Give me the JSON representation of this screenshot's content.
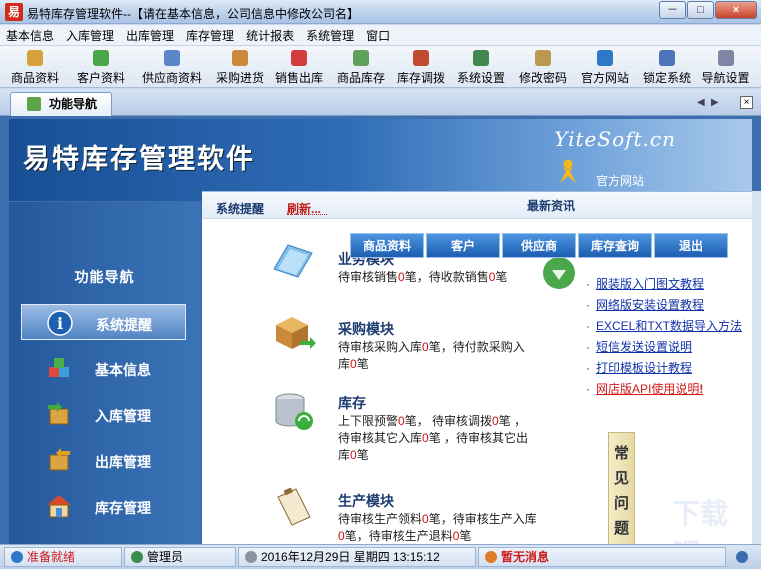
{
  "window": {
    "app_icon_char": "易",
    "title": "易特库存管理软件--【请在基本信息，公司信息中修改公司名】",
    "minimize": "－",
    "maximize": "□",
    "close": "×"
  },
  "menu": [
    "基本信息",
    "入库管理",
    "出库管理",
    "库存管理",
    "统计报表",
    "系统管理",
    "窗口"
  ],
  "toolbar": [
    {
      "label": "商品资料",
      "icon": "goods-icon",
      "color": "#d8a23a"
    },
    {
      "label": "客户资料",
      "icon": "customers-icon",
      "color": "#4aa84a"
    },
    {
      "label": "供应商资料",
      "icon": "supplier-icon",
      "color": "#5a86c8"
    },
    {
      "label": "采购进货",
      "icon": "purchase-icon",
      "color": "#c98a3c"
    },
    {
      "label": "销售出库",
      "icon": "sales-icon",
      "color": "#d23c3c"
    },
    {
      "label": "商品库存",
      "icon": "inventory-icon",
      "color": "#5fa05a"
    },
    {
      "label": "库存调拨",
      "icon": "transfer-icon",
      "color": "#c04a32"
    },
    {
      "label": "系统设置",
      "icon": "settings-icon",
      "color": "#3f8a4c"
    },
    {
      "label": "修改密码",
      "icon": "password-icon",
      "color": "#b99a50"
    },
    {
      "label": "官方网站",
      "icon": "website-icon",
      "color": "#2f78c8"
    },
    {
      "label": "锁定系统",
      "icon": "lock-icon",
      "color": "#4f74b8"
    },
    {
      "label": "导航设置",
      "icon": "nav-settings-icon",
      "color": "#7f86a4"
    }
  ],
  "tab": {
    "label": "功能导航",
    "prev": "◀",
    "next": "▶",
    "close": "×"
  },
  "banner": {
    "title": "易特库存管理软件",
    "logo": "YiteSoft.cn",
    "site_link": "官方网站"
  },
  "leftnav": {
    "heading": "功能导航",
    "items": [
      {
        "label": "系统提醒",
        "icon": "info-icon",
        "active": true
      },
      {
        "label": "基本信息",
        "icon": "cubes-icon",
        "active": false
      },
      {
        "label": "入库管理",
        "icon": "inbound-box-icon",
        "active": false
      },
      {
        "label": "出库管理",
        "icon": "outbound-box-icon",
        "active": false
      },
      {
        "label": "库存管理",
        "icon": "warehouse-icon",
        "active": false
      }
    ]
  },
  "panel": {
    "system_note": "系统提醒",
    "refresh": "刷新...",
    "news_title": "最新资讯",
    "quick_buttons": [
      "商品资料",
      "客户",
      "供应商",
      "库存查询",
      "退出"
    ],
    "modules": [
      {
        "title": "业务模块",
        "parts": [
          "待审核销售",
          "0",
          "笔，待收款销售",
          "0",
          "笔"
        ]
      },
      {
        "title": "采购模块",
        "parts": [
          "待审核采购入库",
          "0",
          "笔，待付款采购入库",
          "0",
          "笔"
        ]
      },
      {
        "title": "库存",
        "parts": [
          "上下限预警",
          "0",
          "笔，  待审核调拨",
          "0",
          "笔  ，待审核其它入库",
          "0",
          "笔  ，待审核其它出库",
          "0",
          "笔"
        ]
      },
      {
        "title": "生产模块",
        "parts": [
          "待审核生产领料",
          "0",
          "笔，待审核生产入库",
          "0",
          "笔，待审核生产退料",
          "0",
          "笔"
        ]
      }
    ],
    "news": [
      {
        "text": "服装版入门图文教程",
        "hot": false
      },
      {
        "text": "网络版安装设置教程",
        "hot": false
      },
      {
        "text": "EXCEL和TXT数据导入方法",
        "hot": false
      },
      {
        "text": "短信发送设置说明",
        "hot": false
      },
      {
        "text": "打印模板设计教程",
        "hot": false
      },
      {
        "text": "网店版API使用说明",
        "hot": true,
        "badge": "!"
      }
    ],
    "faq": [
      "常",
      "见",
      "问",
      "题"
    ],
    "watermark": "下载吧"
  },
  "status": {
    "ready": "准备就绪",
    "user": "管理员",
    "datetime": "2016年12月29日 星期四     13:15:12",
    "message": "暂无消息"
  }
}
